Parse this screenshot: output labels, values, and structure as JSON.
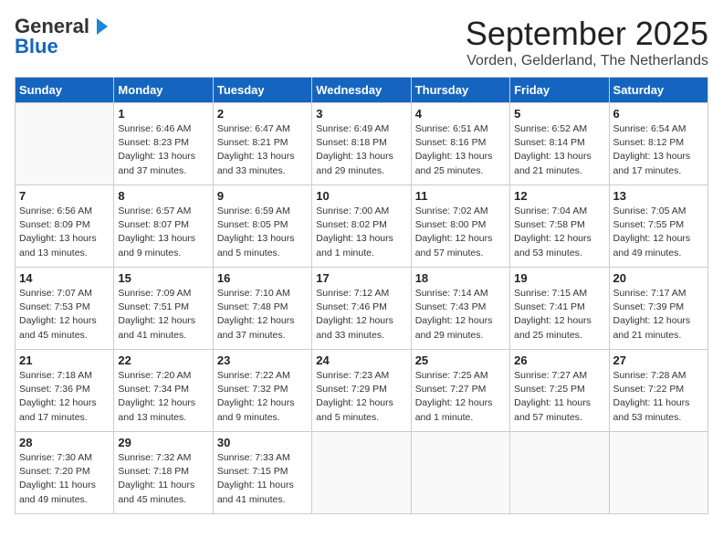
{
  "header": {
    "logo_line1": "General",
    "logo_line2": "Blue",
    "month": "September 2025",
    "location": "Vorden, Gelderland, The Netherlands"
  },
  "weekdays": [
    "Sunday",
    "Monday",
    "Tuesday",
    "Wednesday",
    "Thursday",
    "Friday",
    "Saturday"
  ],
  "weeks": [
    [
      {
        "day": "",
        "info": ""
      },
      {
        "day": "1",
        "info": "Sunrise: 6:46 AM\nSunset: 8:23 PM\nDaylight: 13 hours\nand 37 minutes."
      },
      {
        "day": "2",
        "info": "Sunrise: 6:47 AM\nSunset: 8:21 PM\nDaylight: 13 hours\nand 33 minutes."
      },
      {
        "day": "3",
        "info": "Sunrise: 6:49 AM\nSunset: 8:18 PM\nDaylight: 13 hours\nand 29 minutes."
      },
      {
        "day": "4",
        "info": "Sunrise: 6:51 AM\nSunset: 8:16 PM\nDaylight: 13 hours\nand 25 minutes."
      },
      {
        "day": "5",
        "info": "Sunrise: 6:52 AM\nSunset: 8:14 PM\nDaylight: 13 hours\nand 21 minutes."
      },
      {
        "day": "6",
        "info": "Sunrise: 6:54 AM\nSunset: 8:12 PM\nDaylight: 13 hours\nand 17 minutes."
      }
    ],
    [
      {
        "day": "7",
        "info": "Sunrise: 6:56 AM\nSunset: 8:09 PM\nDaylight: 13 hours\nand 13 minutes."
      },
      {
        "day": "8",
        "info": "Sunrise: 6:57 AM\nSunset: 8:07 PM\nDaylight: 13 hours\nand 9 minutes."
      },
      {
        "day": "9",
        "info": "Sunrise: 6:59 AM\nSunset: 8:05 PM\nDaylight: 13 hours\nand 5 minutes."
      },
      {
        "day": "10",
        "info": "Sunrise: 7:00 AM\nSunset: 8:02 PM\nDaylight: 13 hours\nand 1 minute."
      },
      {
        "day": "11",
        "info": "Sunrise: 7:02 AM\nSunset: 8:00 PM\nDaylight: 12 hours\nand 57 minutes."
      },
      {
        "day": "12",
        "info": "Sunrise: 7:04 AM\nSunset: 7:58 PM\nDaylight: 12 hours\nand 53 minutes."
      },
      {
        "day": "13",
        "info": "Sunrise: 7:05 AM\nSunset: 7:55 PM\nDaylight: 12 hours\nand 49 minutes."
      }
    ],
    [
      {
        "day": "14",
        "info": "Sunrise: 7:07 AM\nSunset: 7:53 PM\nDaylight: 12 hours\nand 45 minutes."
      },
      {
        "day": "15",
        "info": "Sunrise: 7:09 AM\nSunset: 7:51 PM\nDaylight: 12 hours\nand 41 minutes."
      },
      {
        "day": "16",
        "info": "Sunrise: 7:10 AM\nSunset: 7:48 PM\nDaylight: 12 hours\nand 37 minutes."
      },
      {
        "day": "17",
        "info": "Sunrise: 7:12 AM\nSunset: 7:46 PM\nDaylight: 12 hours\nand 33 minutes."
      },
      {
        "day": "18",
        "info": "Sunrise: 7:14 AM\nSunset: 7:43 PM\nDaylight: 12 hours\nand 29 minutes."
      },
      {
        "day": "19",
        "info": "Sunrise: 7:15 AM\nSunset: 7:41 PM\nDaylight: 12 hours\nand 25 minutes."
      },
      {
        "day": "20",
        "info": "Sunrise: 7:17 AM\nSunset: 7:39 PM\nDaylight: 12 hours\nand 21 minutes."
      }
    ],
    [
      {
        "day": "21",
        "info": "Sunrise: 7:18 AM\nSunset: 7:36 PM\nDaylight: 12 hours\nand 17 minutes."
      },
      {
        "day": "22",
        "info": "Sunrise: 7:20 AM\nSunset: 7:34 PM\nDaylight: 12 hours\nand 13 minutes."
      },
      {
        "day": "23",
        "info": "Sunrise: 7:22 AM\nSunset: 7:32 PM\nDaylight: 12 hours\nand 9 minutes."
      },
      {
        "day": "24",
        "info": "Sunrise: 7:23 AM\nSunset: 7:29 PM\nDaylight: 12 hours\nand 5 minutes."
      },
      {
        "day": "25",
        "info": "Sunrise: 7:25 AM\nSunset: 7:27 PM\nDaylight: 12 hours\nand 1 minute."
      },
      {
        "day": "26",
        "info": "Sunrise: 7:27 AM\nSunset: 7:25 PM\nDaylight: 11 hours\nand 57 minutes."
      },
      {
        "day": "27",
        "info": "Sunrise: 7:28 AM\nSunset: 7:22 PM\nDaylight: 11 hours\nand 53 minutes."
      }
    ],
    [
      {
        "day": "28",
        "info": "Sunrise: 7:30 AM\nSunset: 7:20 PM\nDaylight: 11 hours\nand 49 minutes."
      },
      {
        "day": "29",
        "info": "Sunrise: 7:32 AM\nSunset: 7:18 PM\nDaylight: 11 hours\nand 45 minutes."
      },
      {
        "day": "30",
        "info": "Sunrise: 7:33 AM\nSunset: 7:15 PM\nDaylight: 11 hours\nand 41 minutes."
      },
      {
        "day": "",
        "info": ""
      },
      {
        "day": "",
        "info": ""
      },
      {
        "day": "",
        "info": ""
      },
      {
        "day": "",
        "info": ""
      }
    ]
  ]
}
